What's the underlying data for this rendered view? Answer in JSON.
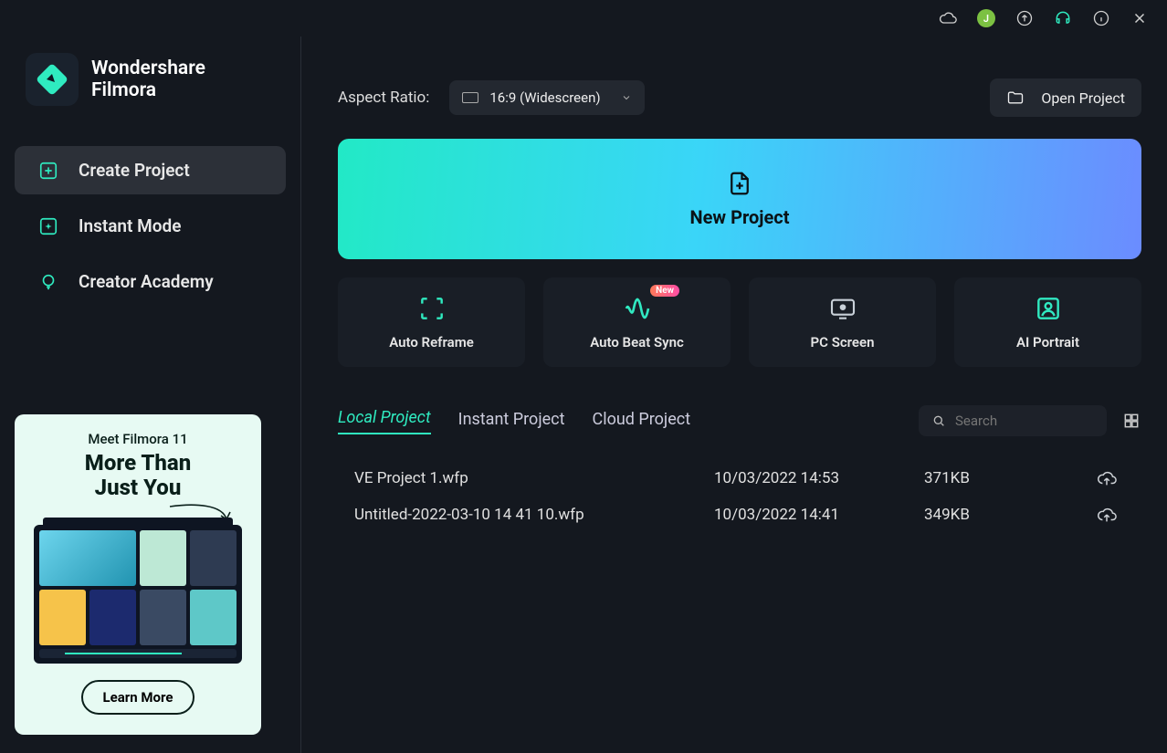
{
  "brand": {
    "line1": "Wondershare",
    "line2": "Filmora"
  },
  "titlebar": {
    "avatar_initial": "J"
  },
  "nav": {
    "items": [
      {
        "label": "Create Project",
        "active": true
      },
      {
        "label": "Instant Mode",
        "active": false
      },
      {
        "label": "Creator Academy",
        "active": false
      }
    ]
  },
  "promo": {
    "subtitle": "Meet Filmora 11",
    "headline1": "More Than",
    "headline2": "Just You",
    "button": "Learn More"
  },
  "aspect": {
    "label": "Aspect Ratio:",
    "value": "16:9 (Widescreen)"
  },
  "open_project": "Open Project",
  "new_project": "New Project",
  "cards": [
    {
      "label": "Auto Reframe"
    },
    {
      "label": "Auto Beat Sync",
      "badge": "New"
    },
    {
      "label": "PC Screen"
    },
    {
      "label": "AI Portrait"
    }
  ],
  "tabs": [
    {
      "label": "Local Project",
      "active": true
    },
    {
      "label": "Instant Project",
      "active": false
    },
    {
      "label": "Cloud Project",
      "active": false
    }
  ],
  "search": {
    "placeholder": "Search"
  },
  "projects": [
    {
      "name": "VE Project 1.wfp",
      "date": "10/03/2022 14:53",
      "size": "371KB"
    },
    {
      "name": "Untitled-2022-03-10 14 41 10.wfp",
      "date": "10/03/2022 14:41",
      "size": "349KB"
    }
  ]
}
